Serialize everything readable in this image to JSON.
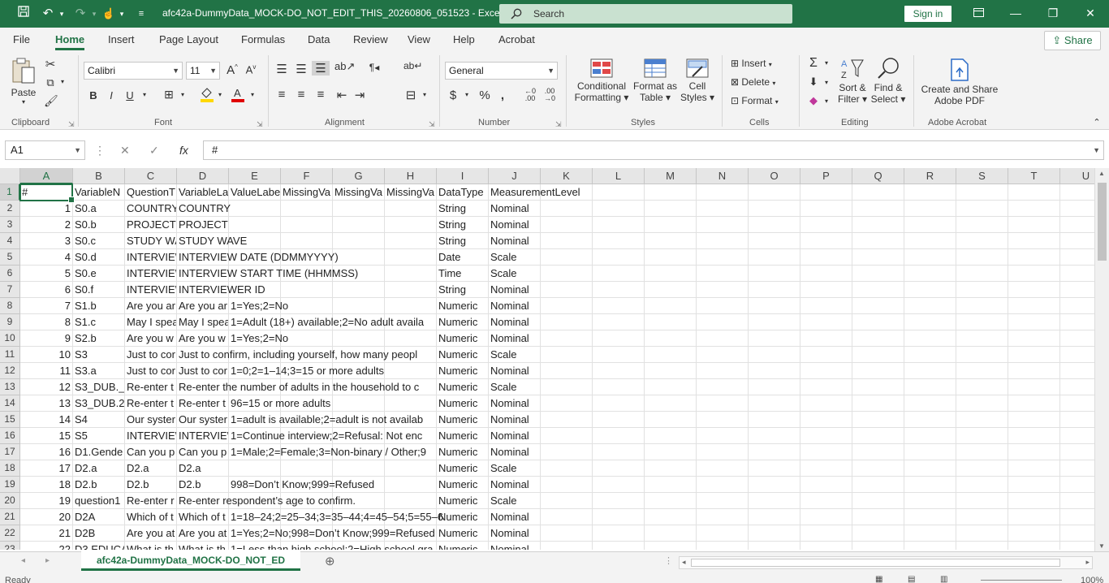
{
  "titlebar": {
    "title": "afc42a-DummyData_MOCK-DO_NOT_EDIT_THIS_20260806_051523  -  Excel",
    "search_placeholder": "Search",
    "signin_label": "Sign in"
  },
  "menu": {
    "tabs": [
      "File",
      "Home",
      "Insert",
      "Page Layout",
      "Formulas",
      "Data",
      "Review",
      "View",
      "Help",
      "Acrobat"
    ],
    "share_label": "Share"
  },
  "ribbon": {
    "clipboard": {
      "paste": "Paste",
      "label": "Clipboard"
    },
    "font": {
      "family": "Calibri",
      "size": "11",
      "label": "Font"
    },
    "alignment": {
      "label": "Alignment"
    },
    "number": {
      "format": "General",
      "label": "Number"
    },
    "styles": {
      "conditional": [
        "Conditional",
        "Formatting"
      ],
      "format_table": [
        "Format as",
        "Table"
      ],
      "cell_styles": [
        "Cell",
        "Styles"
      ],
      "label": "Styles"
    },
    "cells": {
      "insert": "Insert",
      "delete": "Delete",
      "format": "Format",
      "label": "Cells"
    },
    "editing": {
      "sort": [
        "Sort &",
        "Filter"
      ],
      "find": [
        "Find &",
        "Select"
      ],
      "label": "Editing"
    },
    "acrobat": {
      "create": [
        "Create and Share",
        "Adobe PDF"
      ],
      "label": "Adobe Acrobat"
    }
  },
  "formula_bar": {
    "name_box": "A1",
    "fx": "fx",
    "value": "#"
  },
  "columns": [
    "A",
    "B",
    "C",
    "D",
    "E",
    "F",
    "G",
    "H",
    "I",
    "J",
    "K",
    "L",
    "M",
    "N",
    "O",
    "P",
    "Q",
    "R",
    "S",
    "T",
    "U"
  ],
  "rows": [
    [
      "#",
      "VariableN",
      "QuestionT",
      "VariableLa",
      "ValueLabe",
      "MissingVa",
      "MissingVa",
      "MissingVa",
      "DataType",
      "MeasurementLevel"
    ],
    [
      "1",
      "S0.a",
      "COUNTRY",
      "COUNTRY",
      "",
      "",
      "",
      "",
      "String",
      "Nominal"
    ],
    [
      "2",
      "S0.b",
      "PROJECT",
      "PROJECT",
      "",
      "",
      "",
      "",
      "String",
      "Nominal"
    ],
    [
      "3",
      "S0.c",
      "STUDY WA",
      "STUDY WAVE",
      "",
      "",
      "",
      "",
      "String",
      "Nominal"
    ],
    [
      "4",
      "S0.d",
      "INTERVIEW",
      "INTERVIEW DATE (DDMMYYYY)",
      "",
      "",
      "",
      "",
      "Date",
      "Scale"
    ],
    [
      "5",
      "S0.e",
      "INTERVIEW",
      "INTERVIEW START TIME (HHMMSS)",
      "",
      "",
      "",
      "",
      "Time",
      "Scale"
    ],
    [
      "6",
      "S0.f",
      "INTERVIEW",
      "INTERVIEWER ID",
      "",
      "",
      "",
      "",
      "String",
      "Nominal"
    ],
    [
      "7",
      "S1.b",
      "Are you ar",
      "Are you ar",
      "1=Yes;2=No",
      "",
      "",
      "",
      "Numeric",
      "Nominal"
    ],
    [
      "8",
      "S1.c",
      "May I spea",
      "May I spea",
      "1=Adult (18+) available;2=No adult availa",
      "",
      "",
      "",
      "Numeric",
      "Nominal"
    ],
    [
      "9",
      "S2.b",
      "Are you w",
      "Are you w",
      "1=Yes;2=No",
      "",
      "",
      "",
      "Numeric",
      "Nominal"
    ],
    [
      "10",
      "S3",
      "Just to cor",
      "Just to confirm, including yourself, how many peopl",
      "",
      "",
      "",
      "",
      "Numeric",
      "Scale"
    ],
    [
      "11",
      "S3.a",
      "Just to cor",
      "Just to cor",
      "1=0;2=1–14;3=15 or more adults",
      "",
      "",
      "",
      "Numeric",
      "Nominal"
    ],
    [
      "12",
      "S3_DUB._I",
      "Re-enter t",
      "Re-enter the number of adults in the household to c",
      "",
      "",
      "",
      "",
      "Numeric",
      "Scale"
    ],
    [
      "13",
      "S3_DUB.2",
      "Re-enter t",
      "Re-enter t",
      "96=15 or more adults",
      "",
      "",
      "",
      "Numeric",
      "Nominal"
    ],
    [
      "14",
      "S4",
      "Our syster",
      "Our syster",
      "1=adult is available;2=adult is not availab",
      "",
      "",
      "",
      "Numeric",
      "Nominal"
    ],
    [
      "15",
      "S5",
      "INTERVIEW",
      "INTERVIEW",
      "1=Continue interview;2=Refusal: Not enc",
      "",
      "",
      "",
      "Numeric",
      "Nominal"
    ],
    [
      "16",
      "D1.Gende",
      "Can you p",
      "Can you p",
      "1=Male;2=Female;3=Non-binary / Other;9",
      "",
      "",
      "",
      "Numeric",
      "Nominal"
    ],
    [
      "17",
      "D2.a",
      "D2.a",
      "D2.a",
      "",
      "",
      "",
      "",
      "Numeric",
      "Scale"
    ],
    [
      "18",
      "D2.b",
      "D2.b",
      "D2.b",
      "998=Don’t Know;999=Refused",
      "",
      "",
      "",
      "Numeric",
      "Nominal"
    ],
    [
      "19",
      "question1",
      "Re-enter r",
      "Re-enter respondent’s age to confirm.",
      "",
      "",
      "",
      "",
      "Numeric",
      "Scale"
    ],
    [
      "20",
      "D2A",
      "Which of t",
      "Which of t",
      "1=18–24;2=25–34;3=35–44;4=45–54;5=55–6",
      "",
      "",
      "",
      "Numeric",
      "Nominal"
    ],
    [
      "21",
      "D2B",
      "Are you at",
      "Are you at",
      "1=Yes;2=No;998=Don’t Know;999=Refused",
      "",
      "",
      "",
      "Numeric",
      "Nominal"
    ],
    [
      "22",
      "D3.EDUCA",
      "What is th",
      "What is th",
      "1=Less than high school;2=High school gra",
      "",
      "",
      "",
      "Numeric",
      "Nominal"
    ]
  ],
  "sheet": {
    "tab_label": "afc42a-DummyData_MOCK-DO_NOT_ED"
  },
  "status": {
    "ready": "Ready",
    "zoom": "100%"
  },
  "colors": {
    "accent": "#217346"
  }
}
